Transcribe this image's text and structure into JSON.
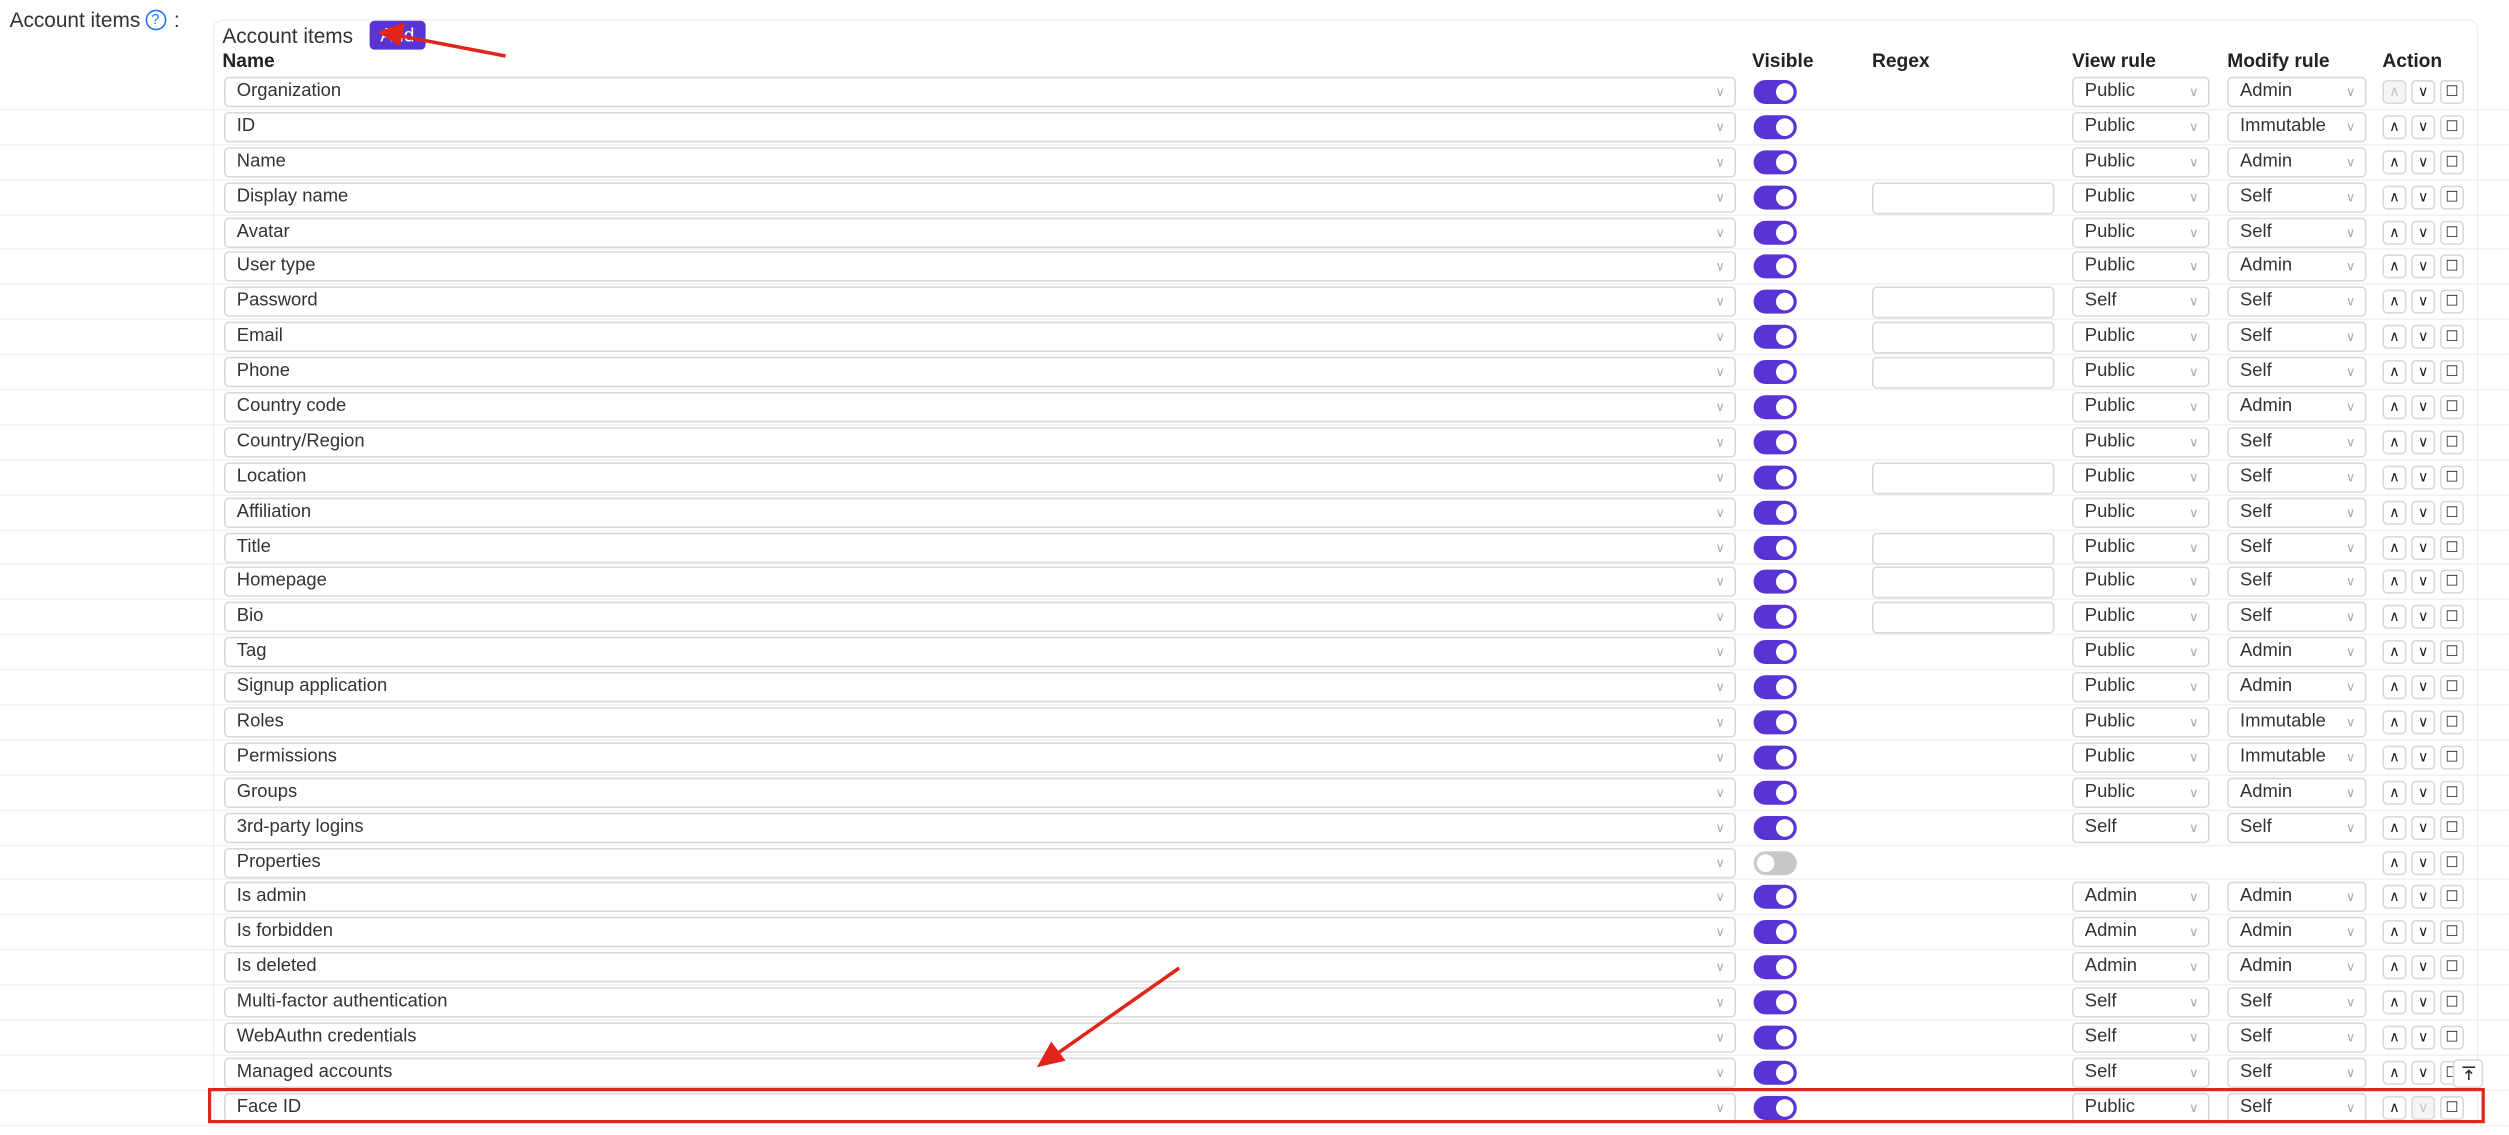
{
  "field": {
    "label": "Account items",
    "separator": ":"
  },
  "card": {
    "title": "Account items",
    "add_label": "Add"
  },
  "columns": {
    "name": "Name",
    "visible": "Visible",
    "regex": "Regex",
    "view_rule": "View rule",
    "modify_rule": "Modify rule",
    "action": "Action"
  },
  "icons": {
    "help": "question-circle-icon",
    "chevron": "chevron-down-icon",
    "up": "arrow-up-icon",
    "down": "arrow-down-icon",
    "delete": "trash-icon",
    "back_to_top": "vertical-align-top-icon"
  },
  "colors": {
    "accent": "#5734d3",
    "highlight": "#e1251b"
  },
  "rows": [
    {
      "name": "Organization",
      "visible": true,
      "regex": false,
      "view": "Public",
      "modify": "Admin"
    },
    {
      "name": "ID",
      "visible": true,
      "regex": false,
      "view": "Public",
      "modify": "Immutable"
    },
    {
      "name": "Name",
      "visible": true,
      "regex": false,
      "view": "Public",
      "modify": "Admin"
    },
    {
      "name": "Display name",
      "visible": true,
      "regex": true,
      "view": "Public",
      "modify": "Self"
    },
    {
      "name": "Avatar",
      "visible": true,
      "regex": false,
      "view": "Public",
      "modify": "Self"
    },
    {
      "name": "User type",
      "visible": true,
      "regex": false,
      "view": "Public",
      "modify": "Admin"
    },
    {
      "name": "Password",
      "visible": true,
      "regex": true,
      "view": "Self",
      "modify": "Self"
    },
    {
      "name": "Email",
      "visible": true,
      "regex": true,
      "view": "Public",
      "modify": "Self"
    },
    {
      "name": "Phone",
      "visible": true,
      "regex": true,
      "view": "Public",
      "modify": "Self"
    },
    {
      "name": "Country code",
      "visible": true,
      "regex": false,
      "view": "Public",
      "modify": "Admin"
    },
    {
      "name": "Country/Region",
      "visible": true,
      "regex": false,
      "view": "Public",
      "modify": "Self"
    },
    {
      "name": "Location",
      "visible": true,
      "regex": true,
      "view": "Public",
      "modify": "Self"
    },
    {
      "name": "Affiliation",
      "visible": true,
      "regex": false,
      "view": "Public",
      "modify": "Self"
    },
    {
      "name": "Title",
      "visible": true,
      "regex": true,
      "view": "Public",
      "modify": "Self"
    },
    {
      "name": "Homepage",
      "visible": true,
      "regex": true,
      "view": "Public",
      "modify": "Self"
    },
    {
      "name": "Bio",
      "visible": true,
      "regex": true,
      "view": "Public",
      "modify": "Self"
    },
    {
      "name": "Tag",
      "visible": true,
      "regex": false,
      "view": "Public",
      "modify": "Admin"
    },
    {
      "name": "Signup application",
      "visible": true,
      "regex": false,
      "view": "Public",
      "modify": "Admin"
    },
    {
      "name": "Roles",
      "visible": true,
      "regex": false,
      "view": "Public",
      "modify": "Immutable"
    },
    {
      "name": "Permissions",
      "visible": true,
      "regex": false,
      "view": "Public",
      "modify": "Immutable"
    },
    {
      "name": "Groups",
      "visible": true,
      "regex": false,
      "view": "Public",
      "modify": "Admin"
    },
    {
      "name": "3rd-party logins",
      "visible": true,
      "regex": false,
      "view": "Self",
      "modify": "Self"
    },
    {
      "name": "Properties",
      "visible": false,
      "regex": false,
      "view": "",
      "modify": ""
    },
    {
      "name": "Is admin",
      "visible": true,
      "regex": false,
      "view": "Admin",
      "modify": "Admin"
    },
    {
      "name": "Is forbidden",
      "visible": true,
      "regex": false,
      "view": "Admin",
      "modify": "Admin"
    },
    {
      "name": "Is deleted",
      "visible": true,
      "regex": false,
      "view": "Admin",
      "modify": "Admin"
    },
    {
      "name": "Multi-factor authentication",
      "visible": true,
      "regex": false,
      "view": "Self",
      "modify": "Self"
    },
    {
      "name": "WebAuthn credentials",
      "visible": true,
      "regex": false,
      "view": "Self",
      "modify": "Self"
    },
    {
      "name": "Managed accounts",
      "visible": true,
      "regex": false,
      "view": "Self",
      "modify": "Self"
    },
    {
      "name": "Face ID",
      "visible": true,
      "regex": false,
      "view": "Public",
      "modify": "Self",
      "highlighted": true
    }
  ]
}
